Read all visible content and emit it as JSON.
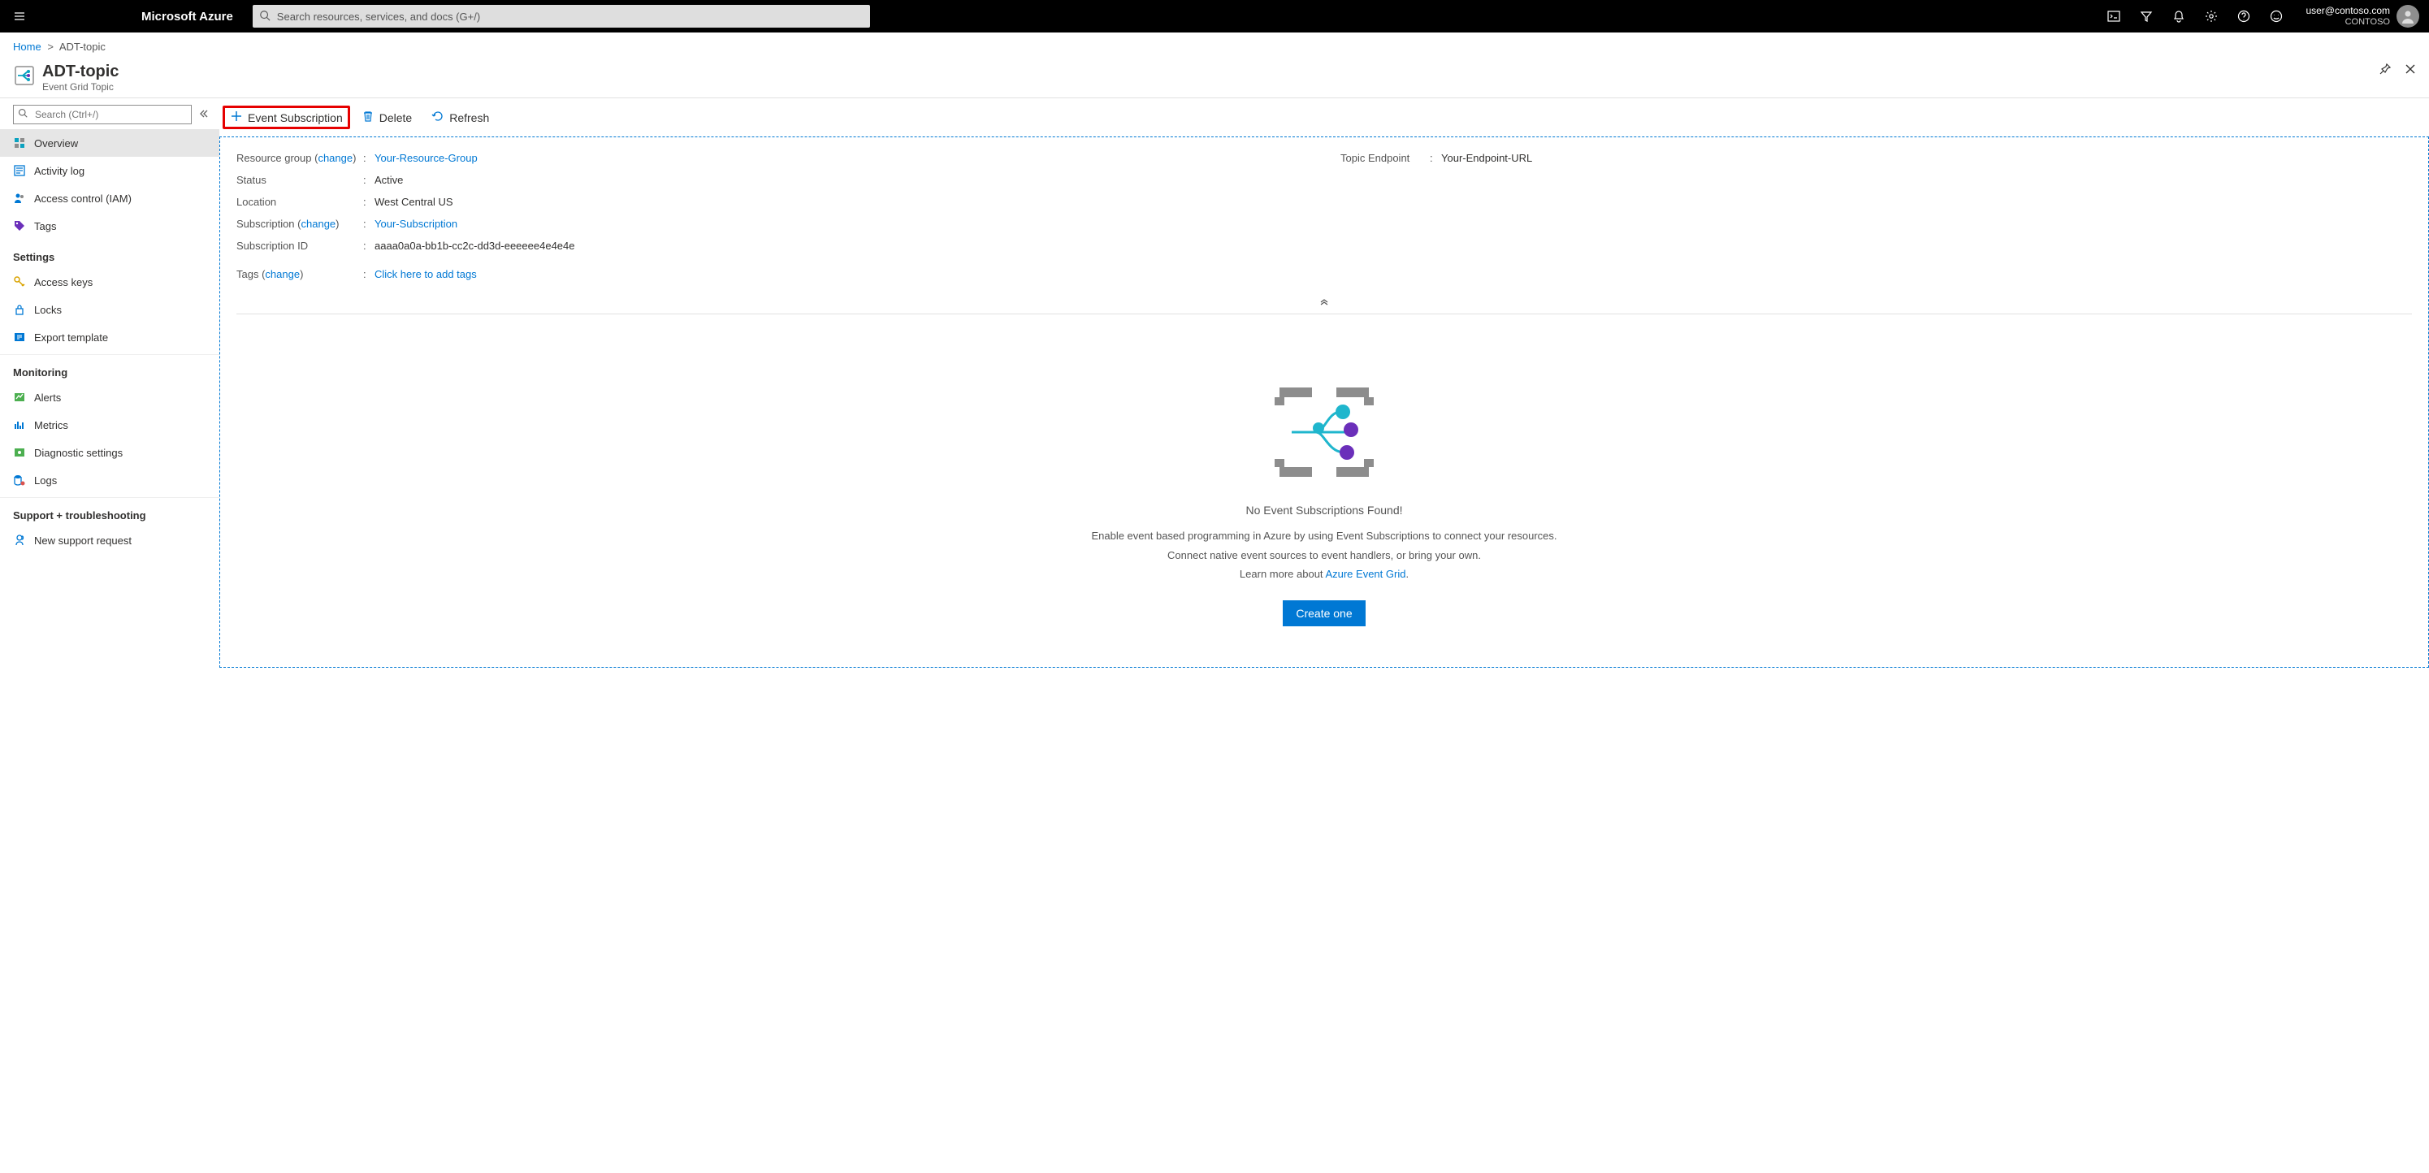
{
  "topbar": {
    "brand": "Microsoft Azure",
    "search_placeholder": "Search resources, services, and docs (G+/)",
    "user_email": "user@contoso.com",
    "user_tenant": "CONTOSO"
  },
  "breadcrumb": {
    "home": "Home",
    "current": "ADT-topic"
  },
  "resource": {
    "title": "ADT-topic",
    "subtitle": "Event Grid Topic"
  },
  "sidebar": {
    "search_placeholder": "Search (Ctrl+/)",
    "items_top": [
      {
        "label": "Overview",
        "icon": "overview"
      },
      {
        "label": "Activity log",
        "icon": "activity"
      },
      {
        "label": "Access control (IAM)",
        "icon": "iam"
      },
      {
        "label": "Tags",
        "icon": "tags"
      }
    ],
    "group_settings": "Settings",
    "items_settings": [
      {
        "label": "Access keys",
        "icon": "key"
      },
      {
        "label": "Locks",
        "icon": "lock"
      },
      {
        "label": "Export template",
        "icon": "export"
      }
    ],
    "group_monitoring": "Monitoring",
    "items_monitoring": [
      {
        "label": "Alerts",
        "icon": "alerts"
      },
      {
        "label": "Metrics",
        "icon": "metrics"
      },
      {
        "label": "Diagnostic settings",
        "icon": "diag"
      },
      {
        "label": "Logs",
        "icon": "logs"
      }
    ],
    "group_support": "Support + troubleshooting",
    "items_support": [
      {
        "label": "New support request",
        "icon": "support"
      }
    ]
  },
  "toolbar": {
    "event_subscription": "Event Subscription",
    "delete": "Delete",
    "refresh": "Refresh"
  },
  "props": {
    "resource_group_label": "Resource group",
    "change_text": "change",
    "resource_group_value": "Your-Resource-Group",
    "status_label": "Status",
    "status_value": "Active",
    "location_label": "Location",
    "location_value": "West Central US",
    "subscription_label": "Subscription",
    "subscription_value": "Your-Subscription",
    "subscription_id_label": "Subscription ID",
    "subscription_id_value": "aaaa0a0a-bb1b-cc2c-dd3d-eeeeee4e4e4e",
    "tags_label": "Tags",
    "tags_value": "Click here to add tags",
    "topic_endpoint_label": "Topic Endpoint",
    "topic_endpoint_value": "Your-Endpoint-URL"
  },
  "empty": {
    "title": "No Event Subscriptions Found!",
    "desc1": "Enable event based programming in Azure by using Event Subscriptions to connect your resources.",
    "desc2": "Connect native event sources to event handlers, or bring your own.",
    "learn_more": "Learn more about ",
    "learn_link": "Azure Event Grid",
    "button": "Create one"
  }
}
